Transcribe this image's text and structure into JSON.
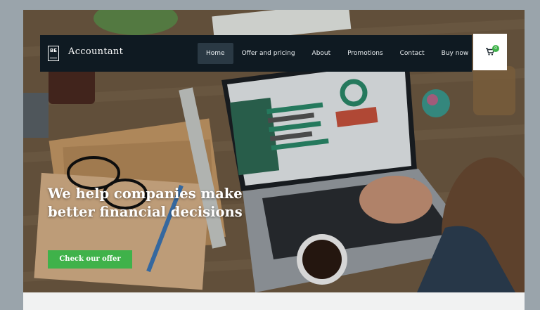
{
  "header": {
    "logo_mark": "BE",
    "brand_name": "Accountant",
    "nav": [
      {
        "label": "Home",
        "active": true
      },
      {
        "label": "Offer and pricing",
        "active": false
      },
      {
        "label": "About",
        "active": false
      },
      {
        "label": "Promotions",
        "active": false
      },
      {
        "label": "Contact",
        "active": false
      },
      {
        "label": "Buy now",
        "active": false
      }
    ],
    "cart": {
      "icon": "shopping-cart-icon",
      "count": "0"
    }
  },
  "hero": {
    "headline": "We help companies make better financial decisions",
    "cta_label": "Check our offer",
    "background": "photo-desk-laptop-accounting"
  },
  "colors": {
    "navbar": "#0f1a22",
    "nav_active": "#2a3944",
    "accent": "#3fb24a",
    "page_bg": "#9aa4ab"
  }
}
